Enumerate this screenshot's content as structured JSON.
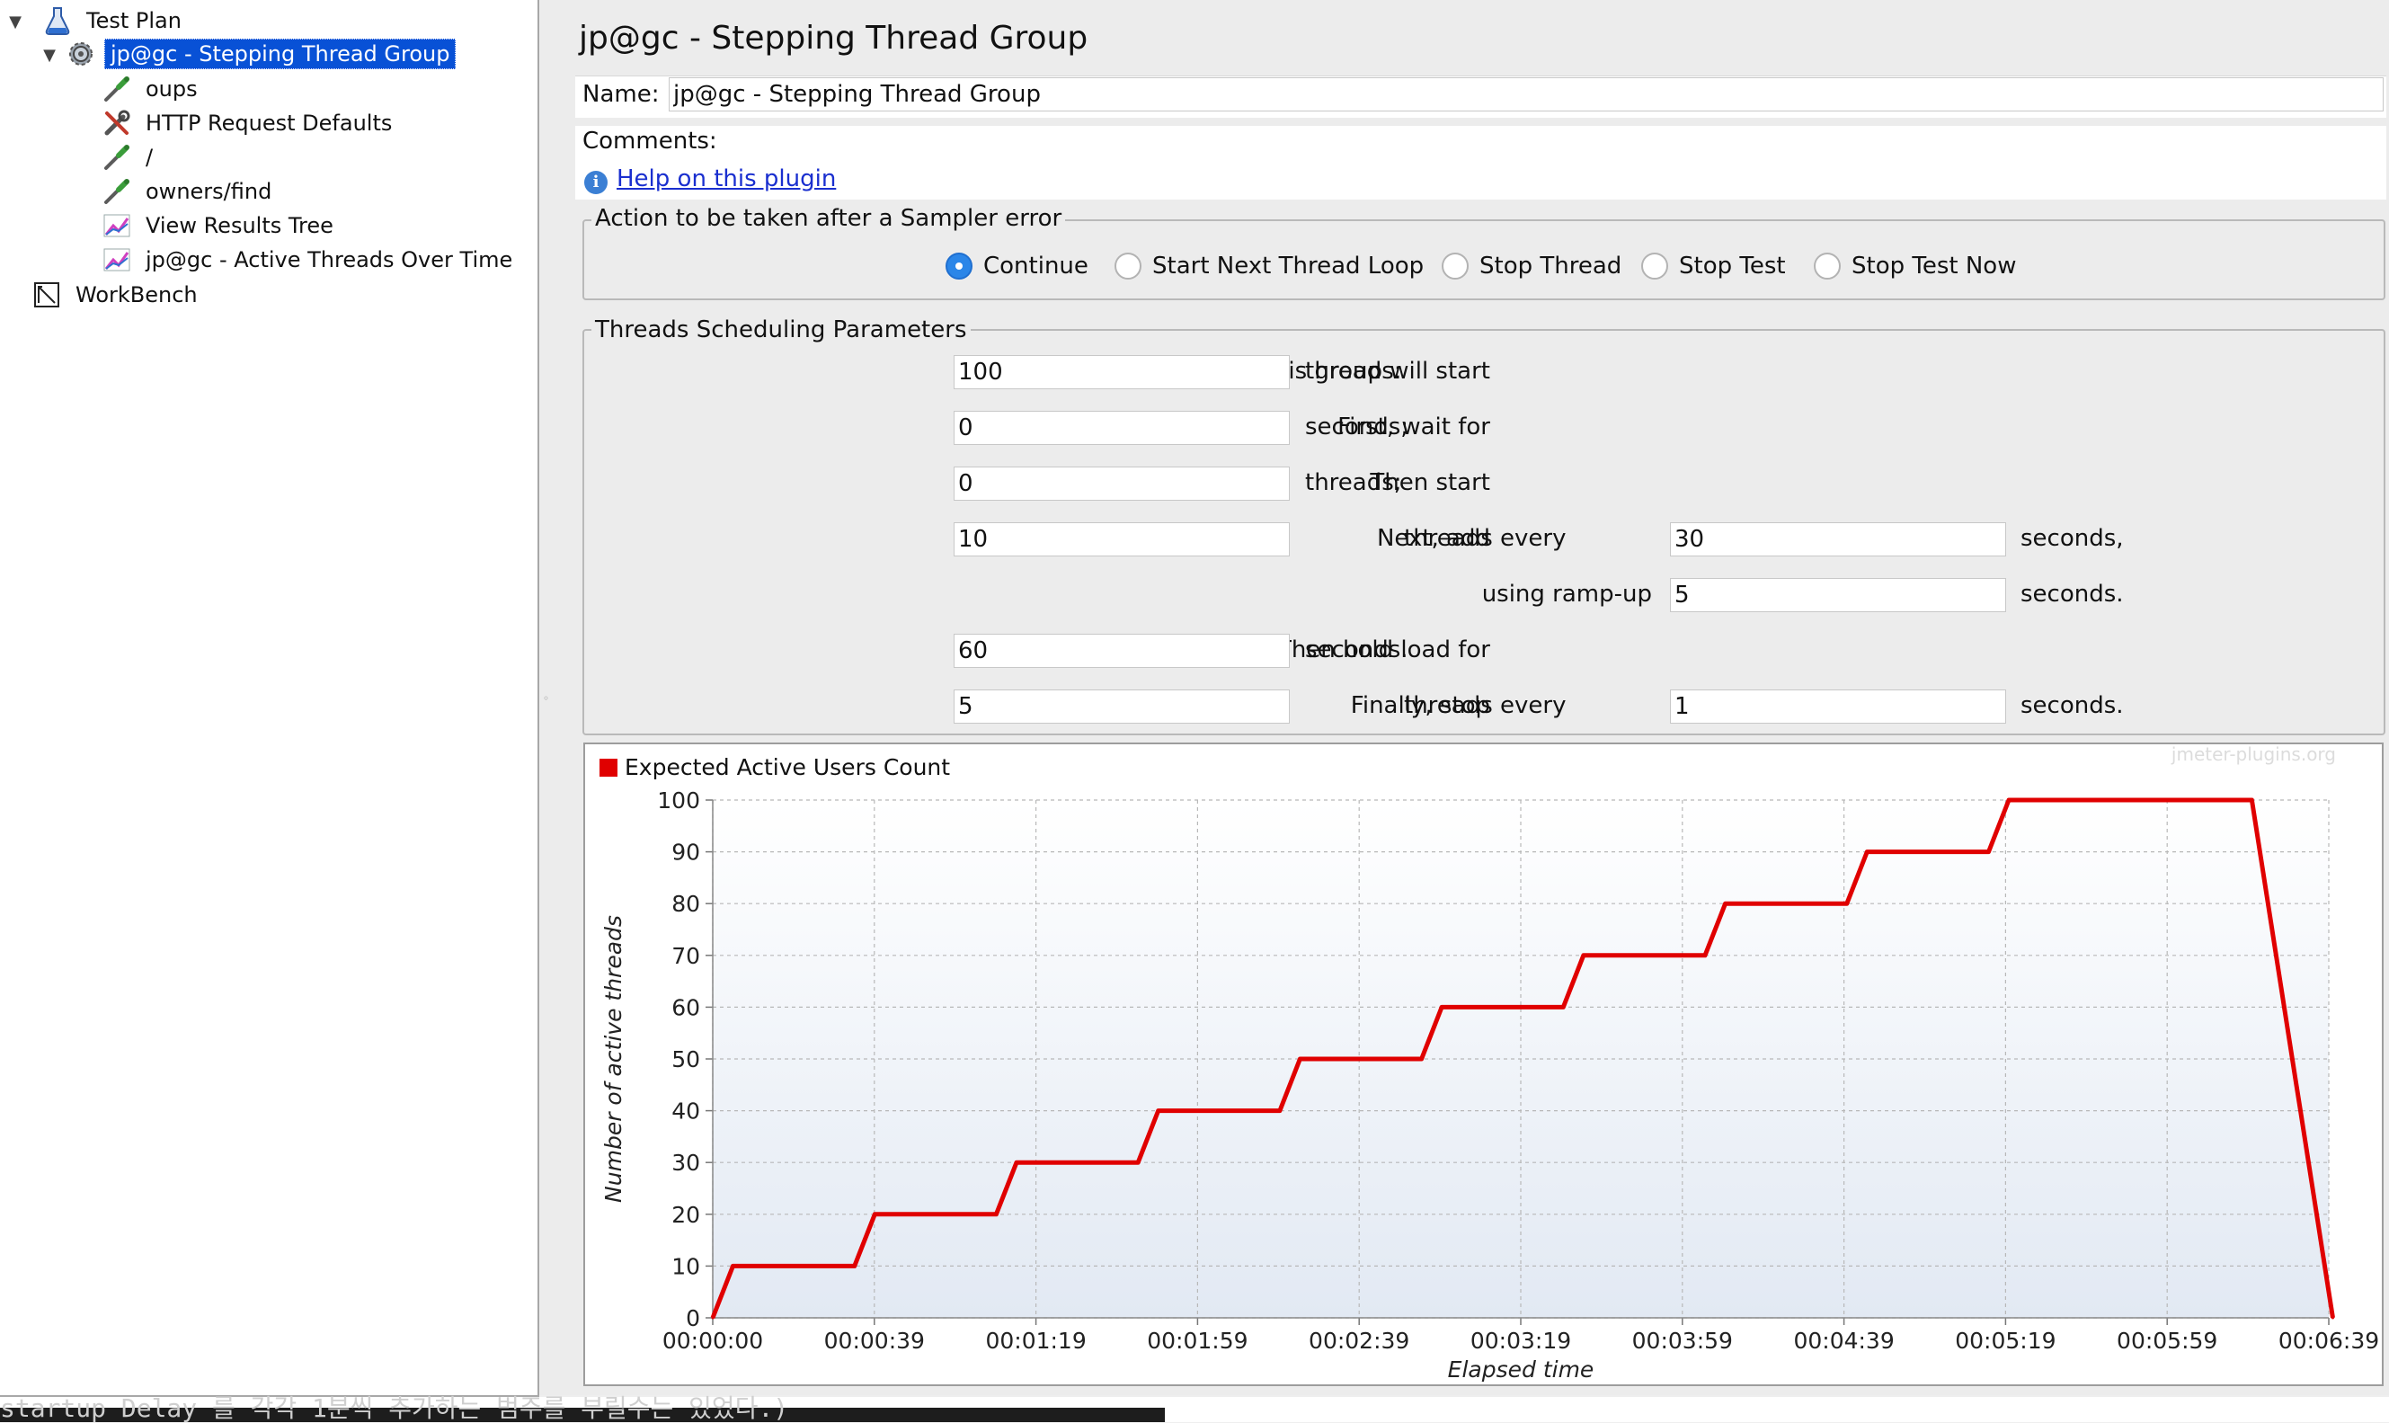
{
  "tree": {
    "items": [
      {
        "label": "Test Plan",
        "icon": "flask-icon",
        "level": 0,
        "toggle": "expanded"
      },
      {
        "label": "jp@gc - Stepping Thread Group",
        "icon": "gear-icon",
        "level": 1,
        "toggle": "expanded",
        "selected": true
      },
      {
        "label": "oups",
        "icon": "pipette-icon",
        "level": 2
      },
      {
        "label": "HTTP Request Defaults",
        "icon": "wrench-icon",
        "level": 2
      },
      {
        "label": "/",
        "icon": "pipette-icon",
        "level": 2
      },
      {
        "label": "owners/find",
        "icon": "pipette-icon",
        "level": 2
      },
      {
        "label": "View Results Tree",
        "icon": "graph-icon",
        "level": 2
      },
      {
        "label": "jp@gc - Active Threads Over Time",
        "icon": "graph-icon",
        "level": 2
      },
      {
        "label": "WorkBench",
        "icon": "workbench-icon",
        "level": 0
      }
    ]
  },
  "panel": {
    "title": "jp@gc - Stepping Thread Group",
    "name_label": "Name:",
    "name_value": "jp@gc - Stepping Thread Group",
    "comments_label": "Comments:",
    "comments_value": "",
    "help_link": "Help on this plugin"
  },
  "sampler_error": {
    "legend": "Action to be taken after a Sampler error",
    "options": [
      "Continue",
      "Start Next Thread Loop",
      "Stop Thread",
      "Stop Test",
      "Stop Test Now"
    ],
    "selected": "Continue"
  },
  "scheduling": {
    "legend": "Threads Scheduling Parameters",
    "group_start_label": "This group will start",
    "group_start_value": "100",
    "group_start_unit": "threads:",
    "wait_label": "First, wait for",
    "wait_value": "0",
    "wait_unit": "seconds;",
    "then_start_label": "Then start",
    "then_start_value": "0",
    "then_start_unit": "threads;",
    "next_add_label": "Next, add",
    "next_add_value": "10",
    "next_add_mid": "threads every",
    "next_add_every_value": "30",
    "next_add_unit": "seconds,",
    "rampup_label": "using ramp-up",
    "rampup_value": "5",
    "rampup_unit": "seconds.",
    "hold_label": "Then hold load for",
    "hold_value": "60",
    "hold_unit": "seconds.",
    "stop_label": "Finally, stop",
    "stop_value": "5",
    "stop_mid": "threads every",
    "stop_every_value": "1",
    "stop_unit": "seconds."
  },
  "chart_data": {
    "type": "line",
    "watermark": "jmeter-plugins.org",
    "xlabel": "Elapsed time",
    "ylabel": "Number of active threads",
    "ylim": [
      0,
      100
    ],
    "xlim_seconds": [
      0,
      399
    ],
    "yticks": [
      0,
      10,
      20,
      30,
      40,
      50,
      60,
      70,
      80,
      90,
      100
    ],
    "xtick_labels": [
      "00:00:00",
      "00:00:39",
      "00:01:19",
      "00:01:59",
      "00:02:39",
      "00:03:19",
      "00:03:59",
      "00:04:39",
      "00:05:19",
      "00:05:59",
      "00:06:39"
    ],
    "grid": true,
    "legend_position": "top-left",
    "series": [
      {
        "name": "Expected Active Users Count",
        "color": "#e00000",
        "x_seconds": [
          0,
          5,
          35,
          40,
          70,
          75,
          105,
          110,
          140,
          145,
          175,
          180,
          210,
          215,
          245,
          250,
          280,
          285,
          315,
          320,
          380,
          381,
          382,
          383,
          384,
          385,
          386,
          387,
          388,
          389,
          390,
          391,
          392,
          393,
          394,
          395,
          396,
          397,
          398,
          399,
          400
        ],
        "y": [
          0,
          10,
          10,
          20,
          20,
          30,
          30,
          40,
          40,
          50,
          50,
          60,
          60,
          70,
          70,
          80,
          80,
          90,
          90,
          100,
          100,
          95,
          90,
          85,
          80,
          75,
          70,
          65,
          60,
          55,
          50,
          45,
          40,
          35,
          30,
          25,
          20,
          15,
          10,
          5,
          0
        ]
      }
    ]
  },
  "bottom_text": "startup Delay 를 각각 1분씩 추가하는 범주를 부릴수는 있었다.)"
}
